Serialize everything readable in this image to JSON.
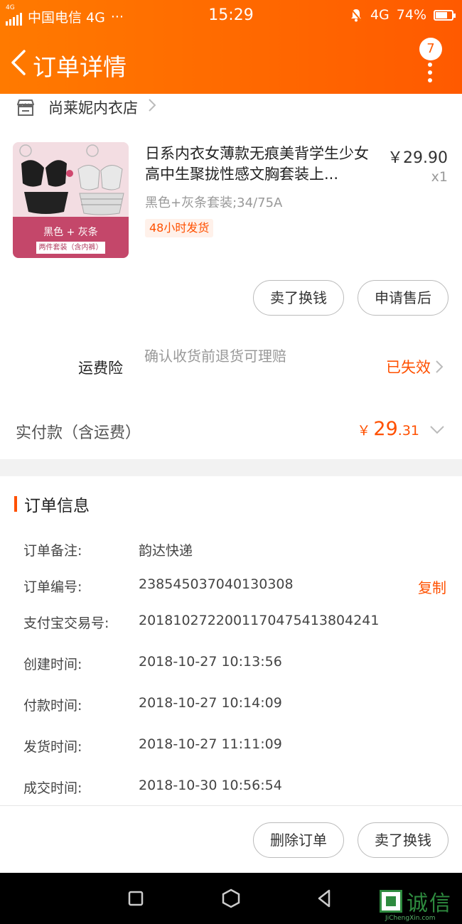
{
  "status_bar": {
    "network_tag": "4G",
    "carrier": "中国电信 4G",
    "more": "···",
    "time": "15:29",
    "network": "4G",
    "battery": "74%",
    "battery_level": 0.74
  },
  "nav": {
    "title": "订单详情",
    "message_count": "7"
  },
  "shop": {
    "name": "尚莱妮内衣店"
  },
  "product": {
    "title": "日系内衣女薄款无痕美背学生少女高中生聚拢性感文胸套装上...",
    "price": "￥29.90",
    "quantity": "x1",
    "sku": "黑色+灰条套装;34/75A",
    "tag": "48小时发货",
    "image_band_text": "黑色 + 灰条",
    "image_band_sub": "两件套装（含内裤）"
  },
  "actions_top": {
    "sell_button": "卖了换钱",
    "after_sale_button": "申请售后"
  },
  "insurance": {
    "label": "运费险",
    "description": "确认收货前退货可理赔",
    "status": "已失效"
  },
  "payment": {
    "label": "实付款（含运费）",
    "currency": "￥",
    "amount_int": "29",
    "amount_dec": ".31"
  },
  "order_info": {
    "title": "订单信息",
    "rows": [
      {
        "key": "订单备注:",
        "value": "韵达快递"
      },
      {
        "key": "订单编号:",
        "value": "238545037040130308"
      },
      {
        "key": "支付宝交易号:",
        "value": "2018102722001170475413804241"
      },
      {
        "key": "创建时间:",
        "value": "2018-10-27 10:13:56"
      },
      {
        "key": "付款时间:",
        "value": "2018-10-27 10:14:09"
      },
      {
        "key": "发货时间:",
        "value": "2018-10-27 11:11:09"
      },
      {
        "key": "成交时间:",
        "value": "2018-10-30 10:56:54"
      }
    ],
    "copy_label": "复制"
  },
  "actions_bottom": {
    "delete_button": "删除订单",
    "sell_button": "卖了换钱"
  },
  "watermark": {
    "text": "诚信",
    "url": "JiChengXin.com"
  }
}
